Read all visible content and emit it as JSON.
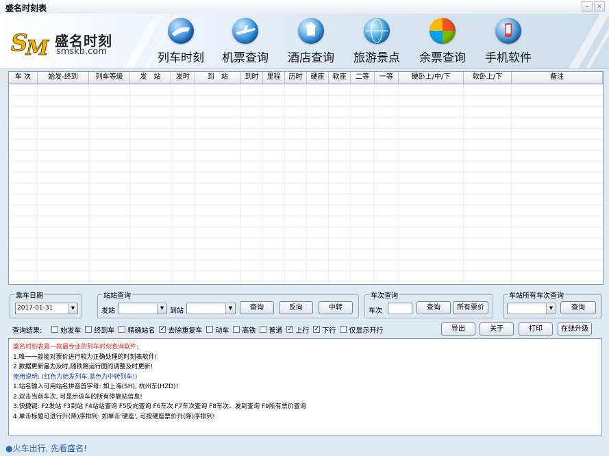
{
  "window": {
    "title": "盛名时刻表"
  },
  "logo": {
    "brand": "盛名时刻",
    "url": "smskb.com"
  },
  "nav": [
    {
      "label": "列车时刻",
      "icon": "train-icon"
    },
    {
      "label": "机票查询",
      "icon": "airplane-icon"
    },
    {
      "label": "酒店查询",
      "icon": "hotel-icon"
    },
    {
      "label": "旅游景点",
      "icon": "globe-icon"
    },
    {
      "label": "余票查询",
      "icon": "ticket-icon"
    },
    {
      "label": "手机软件",
      "icon": "mobile-icon"
    }
  ],
  "grid": {
    "columns": [
      "车 次",
      "始发-终到",
      "列车等级",
      "发　站",
      "发时",
      "到　站",
      "到时",
      "里程",
      "历时",
      "硬座",
      "软座",
      "二等",
      "一等",
      "硬卧上/中/下",
      "软卧上/下",
      "备注"
    ]
  },
  "date_group": {
    "legend": "乘车日期",
    "value": "2017-01-31"
  },
  "station_group": {
    "legend": "站站查询",
    "from_label": "发站",
    "to_label": "到站",
    "query": "查询",
    "reverse": "反向",
    "transfer": "中转"
  },
  "train_group": {
    "legend": "车次查询",
    "train_label": "车次",
    "query": "查询",
    "all_fare": "所有票价"
  },
  "allstation_group": {
    "legend": "车站所有车次查询",
    "query": "查询"
  },
  "filters": {
    "label": "查询结果:",
    "items": [
      {
        "label": "始发车",
        "checked": false
      },
      {
        "label": "终到车",
        "checked": false
      },
      {
        "label": "精确站名",
        "checked": false
      },
      {
        "label": "去除重复车",
        "checked": true
      },
      {
        "label": "动车",
        "checked": false
      },
      {
        "label": "高铁",
        "checked": false
      },
      {
        "label": "普通",
        "checked": false
      },
      {
        "label": "上行",
        "checked": true
      },
      {
        "label": "下行",
        "checked": true
      },
      {
        "label": "仅显示开行",
        "checked": false
      }
    ]
  },
  "actions": {
    "export": "导出",
    "about": "关于",
    "print": "打印",
    "upgrade": "在线升级"
  },
  "info": {
    "lines": [
      {
        "text": "盛名时刻表是一款最专业的列车时刻查询软件:",
        "color": "#e0271c"
      },
      {
        "text": "1.唯一一款能对票价进行较为正确处理的时刻表软件!",
        "color": "#000000"
      },
      {
        "text": "2.数据更新最为及时,随铁路运行图的调整及时更新!",
        "color": "#000000"
      },
      {
        "text": "使用说明: (红色为始发列车,蓝色为中转列车!)",
        "color": "#1c3fd6"
      },
      {
        "text": "1.站名输入可用站名拼音首字母: 如上海(SH), 杭州东(HZD)!",
        "color": "#000000"
      },
      {
        "text": "2.双击当前车次, 可显示该车的所有停靠站信息!",
        "color": "#000000"
      },
      {
        "text": "3.快捷键: F2发站  F3到站  F4站站查询  F5反向查询  F6车次  F7车次查询  F8车次、发到查询  F9所有票价查询",
        "color": "#000000"
      },
      {
        "text": "4.单击标题可进行升(降)序排列: 如单击'硬座', 可按硬座票价升(降)序排列!",
        "color": "#000000"
      }
    ]
  },
  "status": {
    "text": "●火车出行, 先看盛名!"
  }
}
